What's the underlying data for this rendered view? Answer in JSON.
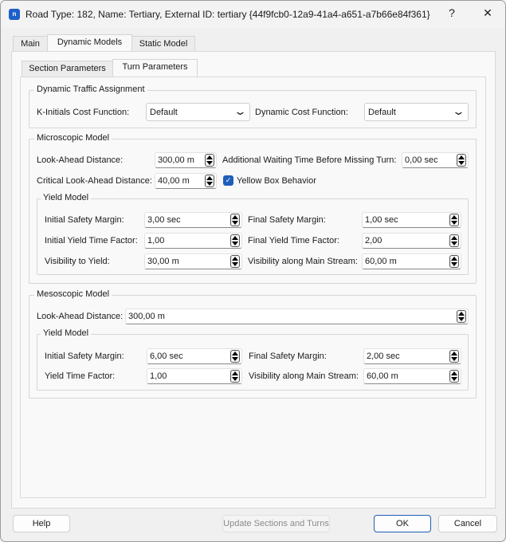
{
  "window": {
    "title": "Road Type: 182, Name: Tertiary, External ID: tertiary  {44f9fcb0-12a9-41a4-a651-a7b66e84f361}",
    "app_icon": "n",
    "help": "?",
    "close": "✕"
  },
  "tabs": [
    "Main",
    "Dynamic Models",
    "Static Model"
  ],
  "subtabs": [
    "Section Parameters",
    "Turn Parameters"
  ],
  "dta": {
    "title": "Dynamic Traffic Assignment",
    "k_label": "K-Initials Cost Function:",
    "k_value": "Default",
    "d_label": "Dynamic Cost Function:",
    "d_value": "Default"
  },
  "micro": {
    "title": "Microscopic Model",
    "lookahead_label": "Look-Ahead Distance:",
    "lookahead": "300,00 m",
    "wait_label": "Additional Waiting Time Before Missing Turn:",
    "wait": "0,00 sec",
    "critical_label": "Critical Look-Ahead Distance:",
    "critical": "40,00 m",
    "yellow_label": "Yellow Box Behavior",
    "yellow_checked": true,
    "yield": {
      "title": "Yield Model",
      "isf_label": "Initial Safety Margin:",
      "isf": "3,00 sec",
      "fsm_label": "Final Safety Margin:",
      "fsm": "1,00 sec",
      "iyt_label": "Initial Yield Time Factor:",
      "iyt": "1,00",
      "fyt_label": "Final Yield Time Factor:",
      "fyt": "2,00",
      "vy_label": "Visibility to Yield:",
      "vy": "30,00 m",
      "vm_label": "Visibility along Main Stream:",
      "vm": "60,00 m"
    }
  },
  "meso": {
    "title": "Mesoscopic Model",
    "lookahead_label": "Look-Ahead Distance:",
    "lookahead": "300,00 m",
    "yield": {
      "title": "Yield Model",
      "isf_label": "Initial Safety Margin:",
      "isf": "6,00 sec",
      "fsm_label": "Final Safety Margin:",
      "fsm": "2,00 sec",
      "ytf_label": "Yield Time Factor:",
      "ytf": "1,00",
      "vm_label": "Visibility along Main Stream:",
      "vm": "60,00 m"
    }
  },
  "buttons": {
    "help": "Help",
    "update": "Update Sections and Turns",
    "ok": "OK",
    "cancel": "Cancel"
  }
}
